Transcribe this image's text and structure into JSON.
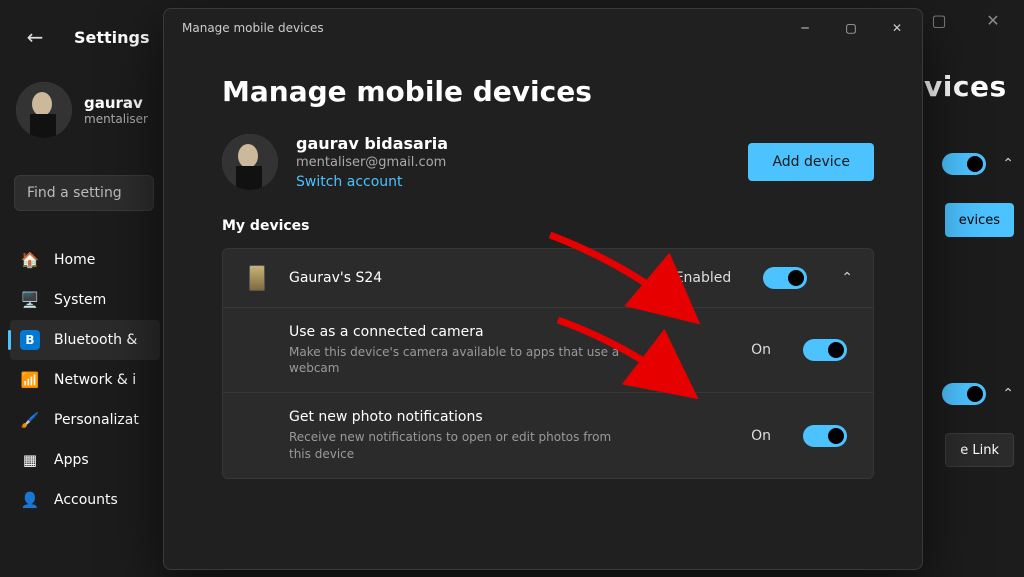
{
  "bg": {
    "title": "Settings",
    "account": {
      "name": "gaurav",
      "sub": "mentaliser"
    },
    "search_placeholder": "Find a setting",
    "nav": [
      {
        "icon": "home-icon",
        "glyph": "🏠",
        "label": "Home"
      },
      {
        "icon": "system-icon",
        "glyph": "🖥️",
        "label": "System"
      },
      {
        "icon": "bluetooth-icon",
        "glyph": "B",
        "label": "Bluetooth &"
      },
      {
        "icon": "wifi-icon",
        "glyph": "📶",
        "label": "Network & i"
      },
      {
        "icon": "personalize-icon",
        "glyph": "🖌️",
        "label": "Personalizat"
      },
      {
        "icon": "apps-icon",
        "glyph": "▦",
        "label": "Apps"
      },
      {
        "icon": "accounts-icon",
        "glyph": "👤",
        "label": "Accounts"
      }
    ],
    "right_title": "devices",
    "right_btn1": "evices",
    "right_btn2": "e Link"
  },
  "modal": {
    "titlebar": "Manage mobile devices",
    "heading": "Manage mobile devices",
    "account": {
      "name": "gaurav bidasaria",
      "email": "mentaliser@gmail.com",
      "switch": "Switch account"
    },
    "add_device": "Add device",
    "section": "My devices",
    "device": {
      "name": "Gaurav's S24",
      "status": "Enabled"
    },
    "rows": [
      {
        "title": "Use as a connected camera",
        "desc": "Make this device's camera available to apps that use a webcam",
        "status": "On"
      },
      {
        "title": "Get new photo notifications",
        "desc": "Receive new notifications to open or edit photos from this device",
        "status": "On"
      }
    ]
  }
}
